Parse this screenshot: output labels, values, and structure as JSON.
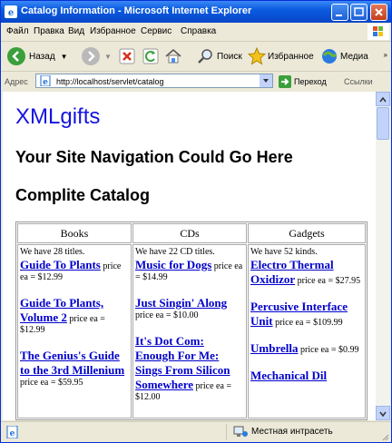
{
  "window": {
    "title": "Catalog Information - Microsoft Internet Explorer"
  },
  "menu": [
    "Файл",
    "Правка",
    "Вид",
    "Избранное",
    "Сервис",
    "Справка"
  ],
  "toolbar": {
    "back": "Назад",
    "search": "Поиск",
    "favorites": "Избранное",
    "media": "Медиа"
  },
  "address": {
    "label": "Адрес",
    "url": "http://localhost/servlet/catalog",
    "go": "Переход",
    "links": "Ссылки"
  },
  "page": {
    "logo": "XMLgifts",
    "nav": "Your Site Navigation Could Go Here",
    "catalog_title": "Complite Catalog",
    "columns": [
      {
        "header": "Books",
        "intro": "We have 28 titles.",
        "items": [
          {
            "name": "Guide To Plants",
            "price": "price ea = $12.99"
          },
          {
            "name": "Guide To Plants, Volume 2",
            "price": "price ea = $12.99"
          },
          {
            "name": "The Genius's Guide to the 3rd Millenium",
            "price": "price ea = $59.95"
          }
        ]
      },
      {
        "header": "CDs",
        "intro": "We have 22 CD titles.",
        "items": [
          {
            "name": "Music for Dogs",
            "price": "price ea = $14.99"
          },
          {
            "name": "Just Singin' Along",
            "price": "price ea = $10.00"
          },
          {
            "name": "It's Dot Com: Enough For Me: Sings From Silicon Somewhere",
            "price": "price ea = $12.00"
          }
        ]
      },
      {
        "header": "Gadgets",
        "intro": "We have 52 kinds.",
        "items": [
          {
            "name": "Electro Thermal Oxidizor",
            "price": "price ea = $27.95"
          },
          {
            "name": "Percusive Interface Unit",
            "price": "price ea = $109.99"
          },
          {
            "name": "Umbrella",
            "price": "price ea = $0.99"
          },
          {
            "name": "Mechanical Dil",
            "price": ""
          }
        ]
      }
    ]
  },
  "status": {
    "zone": "Местная интрасеть"
  },
  "colors": {
    "titlebar": "#0a5be0",
    "chrome": "#ece9d8",
    "link": "#0000cc",
    "logo": "#1414e0"
  }
}
